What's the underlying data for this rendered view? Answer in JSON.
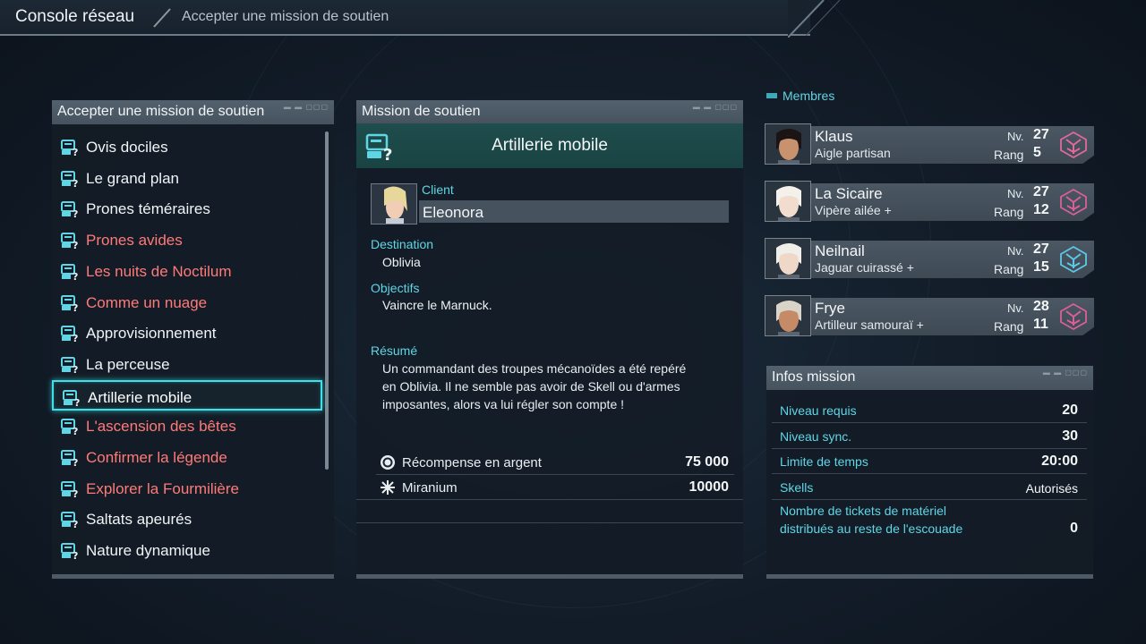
{
  "header": {
    "title": "Console réseau",
    "subtitle": "Accepter une mission de soutien"
  },
  "left_panel": {
    "title": "Accepter une mission de soutien",
    "items": [
      {
        "label": "Ovis dociles",
        "color": "white"
      },
      {
        "label": "Le grand plan",
        "color": "white"
      },
      {
        "label": "Prones téméraires",
        "color": "white"
      },
      {
        "label": "Prones avides",
        "color": "red"
      },
      {
        "label": "Les nuits de Noctilum",
        "color": "red"
      },
      {
        "label": "Comme un nuage",
        "color": "red"
      },
      {
        "label": "Approvisionnement",
        "color": "white"
      },
      {
        "label": "La perceuse",
        "color": "white"
      },
      {
        "label": "Artillerie mobile",
        "color": "white",
        "selected": true
      },
      {
        "label": "L'ascension des bêtes",
        "color": "red"
      },
      {
        "label": "Confirmer la légende",
        "color": "red"
      },
      {
        "label": "Explorer la Fourmilière",
        "color": "red"
      },
      {
        "label": "Saltats apeurés",
        "color": "white"
      },
      {
        "label": "Nature dynamique",
        "color": "white"
      }
    ]
  },
  "detail": {
    "panel_title": "Mission de soutien",
    "mission_name": "Artillerie mobile",
    "client_label": "Client",
    "client_name": "Eleonora",
    "destination_label": "Destination",
    "destination": "Oblivia",
    "objectives_label": "Objectifs",
    "objective": "Vaincre le Marnuck.",
    "summary_label": "Résumé",
    "summary_lines": [
      "Un commandant des troupes mécanoïdes a été repéré",
      "en Oblivia. Il ne semble pas avoir de Skell ou d'armes",
      "imposantes, alors va lui régler son compte !"
    ],
    "rewards": [
      {
        "label": "Récompense en argent",
        "value": "75 000",
        "icon": "coin-icon"
      },
      {
        "label": "Miranium",
        "value": "10000",
        "icon": "miranium-icon"
      }
    ]
  },
  "members": {
    "title": "Membres",
    "level_label": "Nv.",
    "rank_label": "Rang",
    "list": [
      {
        "name": "Klaus",
        "class": "Aigle partisan",
        "level": "27",
        "rank": "5",
        "emblem_color": "#e06a9a"
      },
      {
        "name": "La Sicaire",
        "class": "Vipère ailée +",
        "level": "27",
        "rank": "12",
        "emblem_color": "#d8609a"
      },
      {
        "name": "Neilnail",
        "class": "Jaguar cuirassé +",
        "level": "27",
        "rank": "15",
        "emblem_color": "#5fc7e6"
      },
      {
        "name": "Frye",
        "class": "Artilleur samouraï +",
        "level": "28",
        "rank": "11",
        "emblem_color": "#d8609a"
      }
    ]
  },
  "mission_info": {
    "title": "Infos mission",
    "rows": [
      {
        "label": "Niveau requis",
        "value": "20"
      },
      {
        "label": "Niveau sync.",
        "value": "30"
      },
      {
        "label": "Limite de temps",
        "value": "20:00"
      },
      {
        "label": "Skells",
        "value": "Autorisés"
      }
    ],
    "tickets_label_1": "Nombre de tickets de matériel",
    "tickets_label_2": "distribués au reste de l'escouade",
    "tickets_value": "0"
  },
  "colors": {
    "accent_cyan": "#3fe0ea",
    "label_cyan": "#5fd6e6",
    "item_red": "#ff7a78",
    "mission_title_bg": "#1f4c4c"
  }
}
